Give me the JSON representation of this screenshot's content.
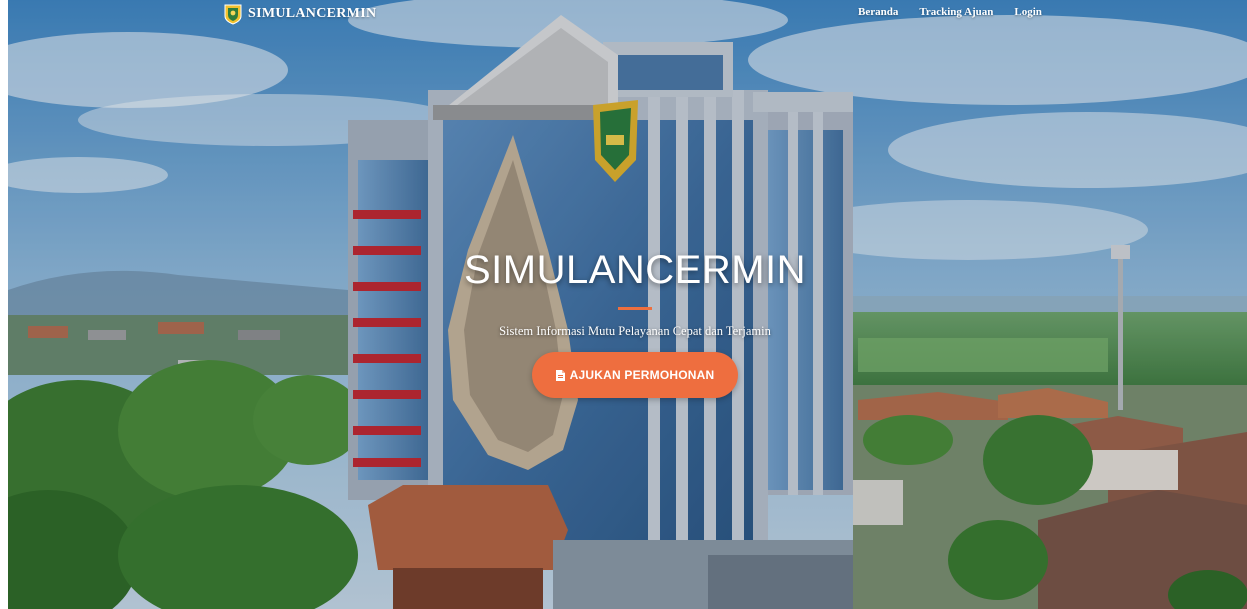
{
  "navbar": {
    "brand_name": "SIMULANCERMIN",
    "brand_logo_icon": "shield-emblem-icon",
    "links": [
      {
        "label": "Beranda"
      },
      {
        "label": "Tracking Ajuan"
      },
      {
        "label": "Login"
      }
    ]
  },
  "hero": {
    "title": "SIMULANCERMIN",
    "subtitle": "Sistem Informasi Mutu Pelayanan Cepat dan Terjamin",
    "cta": {
      "label": "AJUKAN PERMOHONAN",
      "icon": "file-icon"
    }
  },
  "colors": {
    "accent": "#ee6e3f",
    "text": "#ffffff"
  }
}
